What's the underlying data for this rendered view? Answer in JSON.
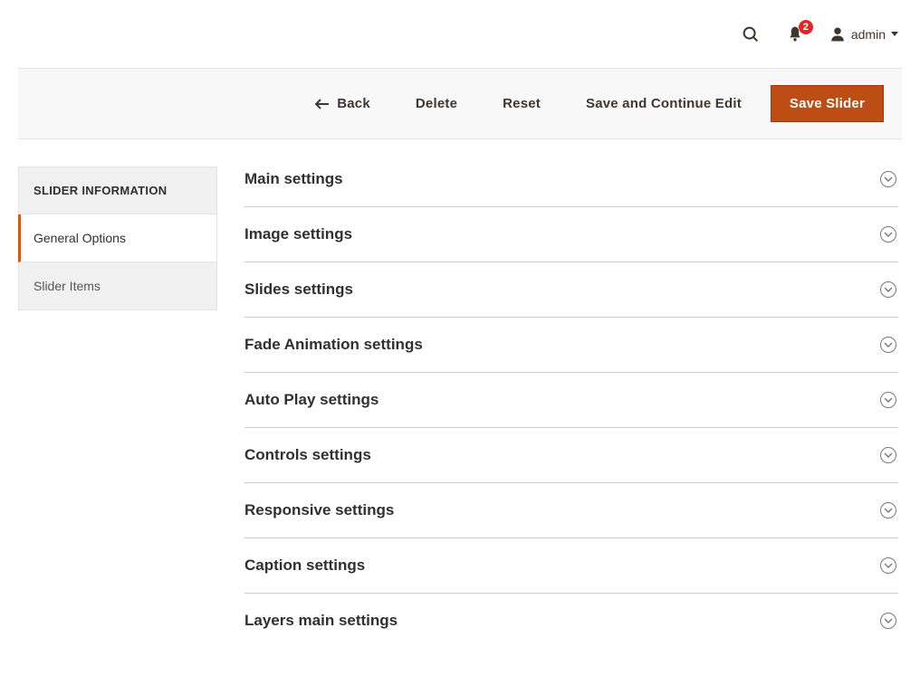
{
  "header": {
    "notification_count": "2",
    "user_label": "admin"
  },
  "actions": {
    "back": "Back",
    "delete": "Delete",
    "reset": "Reset",
    "save_continue": "Save and Continue Edit",
    "save": "Save Slider"
  },
  "sidebar": {
    "header": "SLIDER INFORMATION",
    "items": [
      {
        "label": "General Options",
        "active": true
      },
      {
        "label": "Slider Items",
        "active": false
      }
    ]
  },
  "sections": [
    {
      "title": "Main settings"
    },
    {
      "title": "Image settings"
    },
    {
      "title": "Slides settings"
    },
    {
      "title": "Fade Animation settings"
    },
    {
      "title": "Auto Play settings"
    },
    {
      "title": "Controls settings"
    },
    {
      "title": "Responsive settings"
    },
    {
      "title": "Caption settings"
    },
    {
      "title": "Layers main settings"
    }
  ]
}
